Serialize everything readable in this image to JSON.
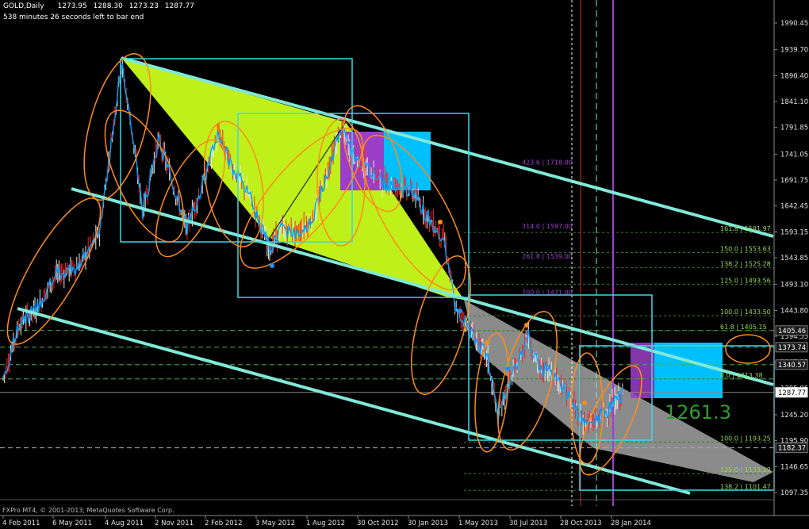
{
  "header": {
    "symbol": "GOLD,Daily",
    "ohlc": [
      "1273.95",
      "1288.30",
      "1273.23",
      "1287.77"
    ],
    "timer": "538 minutes 26 seconds left to bar end"
  },
  "footer": {
    "copyright": "FXPro MT4, © 2001-2013, MetaQuotes Software Corp."
  },
  "colors": {
    "background": "#000000",
    "channel": "#7fe9d8",
    "box": "#3cd8e8",
    "ellipse": "#ff8c1a",
    "wedge_green": "#bff01a",
    "wedge_gray": "#9a9a9a",
    "price_line": "#00a0ff",
    "candle_red": "#ff2020",
    "fib_green": "#9ad84a",
    "fib_purple": "#9b40d0",
    "current_price": "#ffffff"
  },
  "chart_data": {
    "type": "candlestick-with-drawings",
    "symbol": "GOLD",
    "timeframe": "Daily",
    "x_ticks": [
      "4 Feb 2011",
      "6 May 2011",
      "4 Aug 2011",
      "2 Nov 2011",
      "2 Feb 2012",
      "3 May 2012",
      "1 Aug 2012",
      "30 Oct 2012",
      "30 Jan 2013",
      "1 May 2013",
      "30 Jul 2013",
      "28 Oct 2013",
      "28 Jan 2014"
    ],
    "y_ticks": [
      "1990.45",
      "1939.70",
      "1890.40",
      "1841.10",
      "1791.85",
      "1741.05",
      "1691.75",
      "1642.45",
      "1593.15",
      "1543.85",
      "1493.10",
      "1443.80",
      "1394.55",
      "1345.25",
      "1295.95",
      "1245.20",
      "1195.90",
      "1146.65",
      "1097.35"
    ],
    "price_tags": [
      {
        "label": "1405.46",
        "value": 1405.46,
        "style": "dark"
      },
      {
        "label": "1373.74",
        "value": 1373.74,
        "style": "dark"
      },
      {
        "label": "1340.57",
        "value": 1340.57,
        "style": "dark"
      },
      {
        "label": "1287.77",
        "value": 1287.77,
        "style": "current"
      },
      {
        "label": "1182.37",
        "value": 1182.37,
        "style": "dark"
      }
    ],
    "fib_levels_purple": [
      {
        "label": "423.6 | 1718.00",
        "value": 1718.0
      },
      {
        "label": "314.0 | 1597.00",
        "value": 1597.0
      },
      {
        "label": "261.8 | 1539.00",
        "value": 1539.0
      },
      {
        "label": "200.0 | 1471.00",
        "value": 1471.0
      }
    ],
    "fib_levels_green": [
      {
        "label": "161.8 | 1591.97",
        "value": 1591.97
      },
      {
        "label": "150.0 | 1553.63",
        "value": 1553.63
      },
      {
        "label": "138.2 | 1525.28",
        "value": 1525.28
      },
      {
        "label": "125.0 | 1493.56",
        "value": 1493.56
      },
      {
        "label": "100.0 | 1433.50",
        "value": 1433.5
      },
      {
        "label": "61.8 | 1405.15",
        "value": 1405.15
      },
      {
        "label": "0.0 | 1313.38",
        "value": 1313.38
      },
      {
        "label": "100.0 | 1193.25",
        "value": 1193.25
      },
      {
        "label": "125.0 | 1133.19",
        "value": 1133.19
      },
      {
        "label": "138.2 | 1101.47",
        "value": 1101.47
      }
    ],
    "big_label": "1261.3",
    "last_close": 1287.77
  }
}
